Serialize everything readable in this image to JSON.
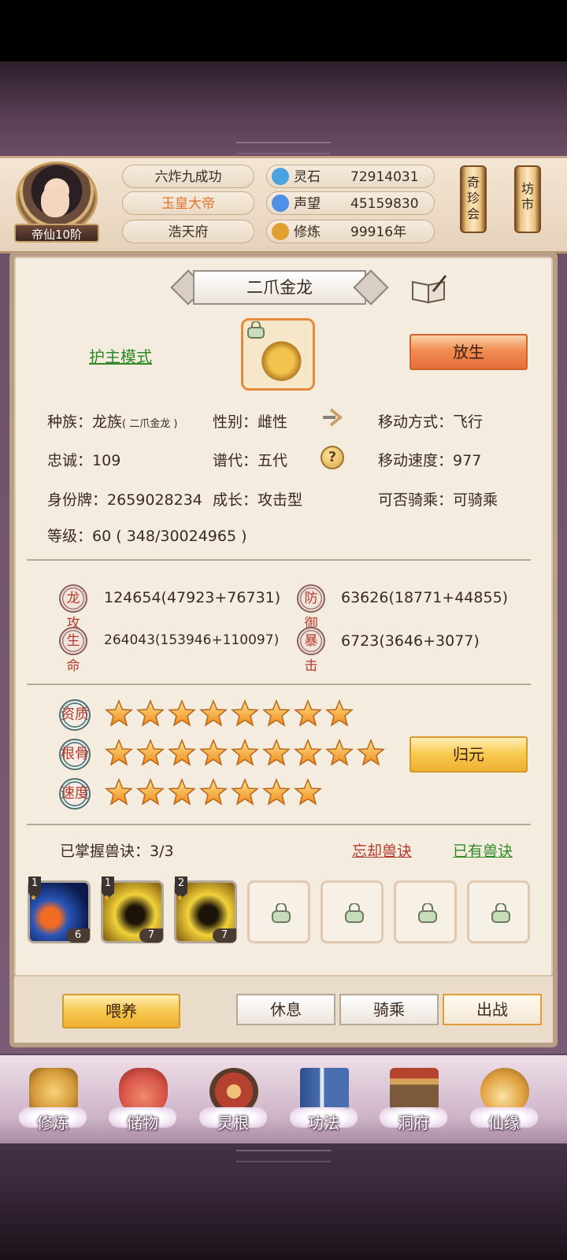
{
  "header": {
    "rank": "帝仙10阶",
    "title_1": "六炸九成功",
    "title_2": "玉皇大帝",
    "title_3": "浩天府",
    "resources": [
      {
        "label": "灵石",
        "value": "72914031",
        "icon": "spirit-stone-icon",
        "color": "#4aa3e0"
      },
      {
        "label": "声望",
        "value": "45159830",
        "icon": "prestige-icon",
        "color": "#4f8fe6"
      },
      {
        "label": "修炼",
        "value": "99916年",
        "icon": "meditation-icon",
        "color": "#e0a030"
      }
    ],
    "shop_1": "奇珍会",
    "shop_2": "坊市"
  },
  "pet": {
    "name": "二爪金龙",
    "mode_link": "护主模式",
    "release_button": "放生",
    "race_label": "种族：",
    "race_value": "龙族",
    "race_sub": "( 二爪金龙 )",
    "gender_label": "性别：",
    "gender_value": "雌性",
    "move_mode_label": "移动方式：",
    "move_mode_value": "飞行",
    "loyalty_label": "忠诚：",
    "loyalty_value": "109",
    "generation_label": "谱代：",
    "generation_value": "五代",
    "move_speed_label": "移动速度：",
    "move_speed_value": "977",
    "id_label": "身份牌：",
    "id_value": "2659028234",
    "growth_label": "成长：",
    "growth_value": "攻击型",
    "rideable_label": "可否骑乘：",
    "rideable_value": "可骑乘",
    "level_label": "等级：",
    "level_value": "60",
    "level_exp": "( 348/30024965 )"
  },
  "stats": [
    {
      "badge": "龙攻",
      "value": "124654(47923+76731)"
    },
    {
      "badge": "防御",
      "value": "63626(18771+44855)"
    },
    {
      "badge": "生命",
      "value": "264043(153946+110097)"
    },
    {
      "badge": "暴击",
      "value": "6723(3646+3077)"
    }
  ],
  "attributes": [
    {
      "badge": "资质",
      "stars": 8
    },
    {
      "badge": "根骨",
      "stars": 9
    },
    {
      "badge": "速度",
      "stars": 7
    }
  ],
  "return_button": "归元",
  "skills": {
    "label": "已掌握兽诀：3/3",
    "forget_link": "忘却兽诀",
    "owned_link": "已有兽诀",
    "slots": [
      {
        "level": "1",
        "count": "6"
      },
      {
        "level": "1",
        "count": "7"
      },
      {
        "level": "2",
        "count": "7"
      }
    ]
  },
  "actions": {
    "feed": "喂养",
    "rest": "休息",
    "ride": "骑乘",
    "battle": "出战"
  },
  "nav": [
    {
      "label": "修炼",
      "icon": "cultivate-icon",
      "color": "#d49a3a"
    },
    {
      "label": "储物",
      "icon": "storage-bag-icon",
      "color": "#d9564a"
    },
    {
      "label": "灵根",
      "icon": "spirit-root-icon",
      "color": "#b5422e"
    },
    {
      "label": "功法",
      "icon": "technique-book-icon",
      "color": "#4a6db0"
    },
    {
      "label": "洞府",
      "icon": "cave-mansion-icon",
      "color": "#b07a3a"
    },
    {
      "label": "仙缘",
      "icon": "fortune-gourd-icon",
      "color": "#e0a040"
    }
  ]
}
